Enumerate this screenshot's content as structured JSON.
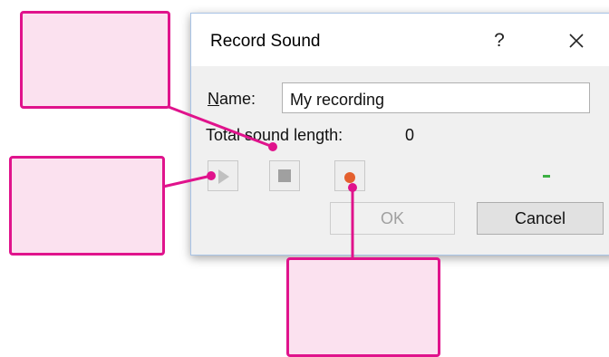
{
  "dialog": {
    "title": "Record Sound",
    "help_glyph": "?",
    "name_label_mnemonic": "N",
    "name_label_rest": "ame:",
    "name_value": "My recording",
    "length_label": "Total sound length:",
    "length_value": "0",
    "ok_label": "OK",
    "cancel_label": "Cancel",
    "level_indicator": "-"
  },
  "colors": {
    "callout_border": "#e0138c",
    "callout_fill": "#fbe1ef",
    "record_dot": "#e4602e",
    "level_green": "#3cb043"
  },
  "icons": [
    "help-icon",
    "close-icon",
    "play-icon",
    "stop-icon",
    "record-icon"
  ]
}
